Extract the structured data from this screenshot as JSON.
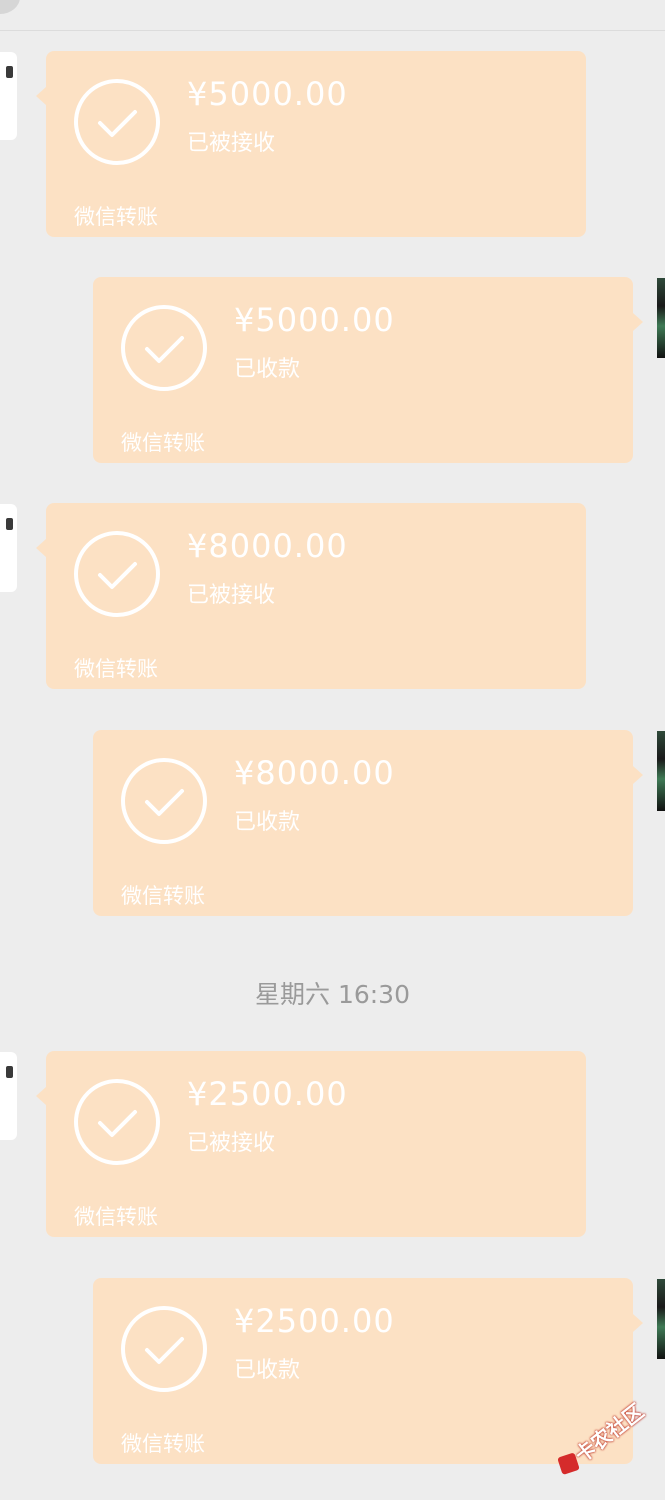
{
  "transfer_label": "微信转账",
  "messages": [
    {
      "direction": "in",
      "amount": "¥5000.00",
      "status": "已被接收"
    },
    {
      "direction": "out",
      "amount": "¥5000.00",
      "status": "已收款"
    },
    {
      "direction": "in",
      "amount": "¥8000.00",
      "status": "已被接收"
    },
    {
      "direction": "out",
      "amount": "¥8000.00",
      "status": "已收款"
    },
    {
      "direction": "in",
      "amount": "¥2500.00",
      "status": "已被接收"
    },
    {
      "direction": "out",
      "amount": "¥2500.00",
      "status": "已收款"
    }
  ],
  "timestamp": "星期六 16:30",
  "watermark": "卡农社区",
  "colors": {
    "bubble": "#fce1c4",
    "background": "#ededed",
    "text": "#ffffff",
    "timestamp": "#9a9a9a"
  }
}
